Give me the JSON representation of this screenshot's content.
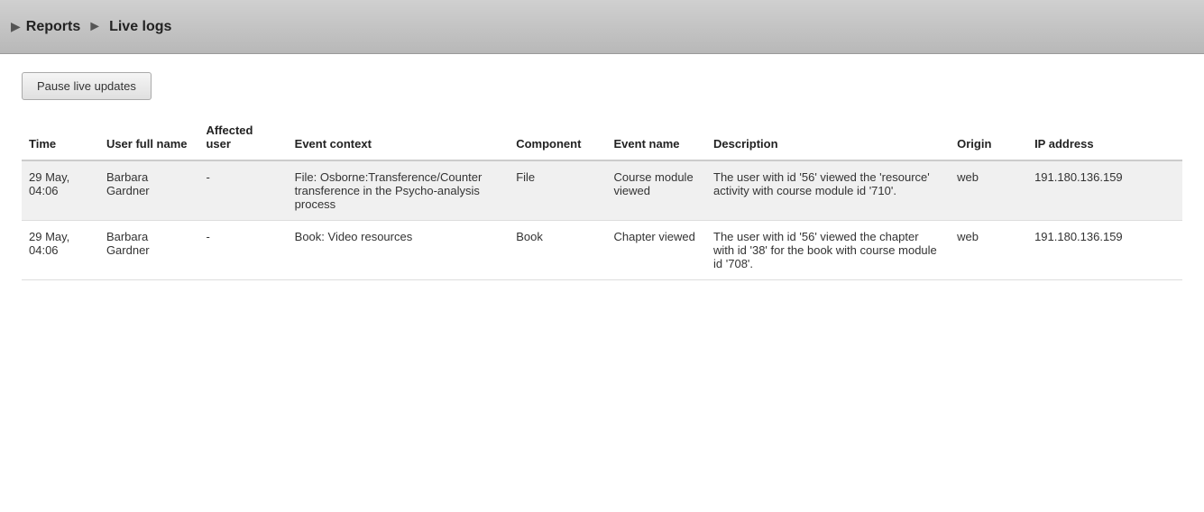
{
  "breadcrumb": {
    "arrow": "▶",
    "parent": "Reports",
    "separator": "►",
    "current": "Live logs"
  },
  "toolbar": {
    "pause_button_label": "Pause live updates"
  },
  "table": {
    "headers": {
      "time": "Time",
      "user_full_name": "User full name",
      "affected_user": "Affected user",
      "event_context": "Event context",
      "component": "Component",
      "event_name": "Event name",
      "description": "Description",
      "origin": "Origin",
      "ip_address": "IP address"
    },
    "rows": [
      {
        "time": "29 May, 04:06",
        "user_full_name": "Barbara Gardner",
        "affected_user": "-",
        "event_context": "File: Osborne:Transference/Counter transference in the Psycho-analysis process",
        "component": "File",
        "event_name": "Course module viewed",
        "description": "The user with id '56' viewed the 'resource' activity with course module id '710'.",
        "origin": "web",
        "ip_address": "191.180.136.159"
      },
      {
        "time": "29 May, 04:06",
        "user_full_name": "Barbara Gardner",
        "affected_user": "-",
        "event_context": "Book: Video resources",
        "component": "Book",
        "event_name": "Chapter viewed",
        "description": "The user with id '56' viewed the chapter with id '38' for the book with course module id '708'.",
        "origin": "web",
        "ip_address": "191.180.136.159"
      }
    ]
  }
}
